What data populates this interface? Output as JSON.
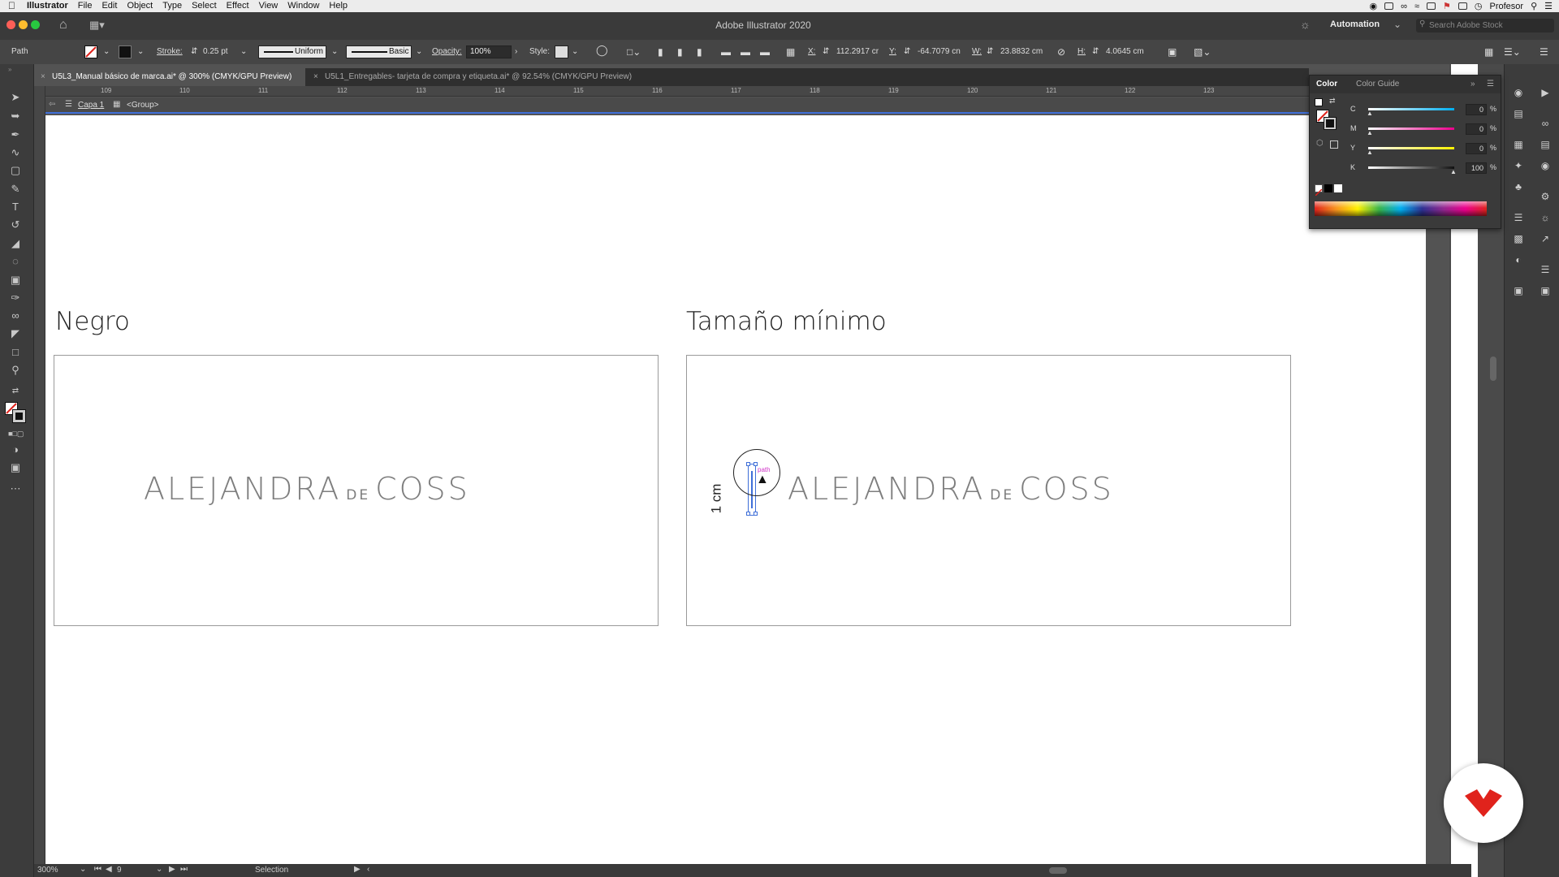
{
  "menubar": {
    "apple": "",
    "app_name": "Illustrator",
    "items": [
      "File",
      "Edit",
      "Object",
      "Type",
      "Select",
      "Effect",
      "View",
      "Window",
      "Help"
    ],
    "user": "Profesor"
  },
  "window": {
    "title": "Adobe Illustrator 2020",
    "workspace": "Automation",
    "search_placeholder": "Search Adobe Stock"
  },
  "control": {
    "selection_type": "Path",
    "stroke_label": "Stroke:",
    "stroke_value": "0.25 pt",
    "profile": "Uniform",
    "brush": "Basic",
    "opacity_label": "Opacity:",
    "opacity_value": "100%",
    "style_label": "Style:",
    "x_label": "X:",
    "x_value": "112.2917 cr",
    "y_label": "Y:",
    "y_value": "-64.7079 cn",
    "w_label": "W:",
    "w_value": "23.8832 cm",
    "h_label": "H:",
    "h_value": "4.0645 cm"
  },
  "tabs": [
    {
      "label": "U5L3_Manual básico de marca.ai* @ 300% (CMYK/GPU Preview)",
      "active": true
    },
    {
      "label": "U5L1_Entregables- tarjeta de compra y etiqueta.ai* @ 92.54% (CMYK/GPU Preview)",
      "active": false
    }
  ],
  "ruler": {
    "ticks": [
      "109",
      "110",
      "111",
      "112",
      "113",
      "114",
      "115",
      "116",
      "117",
      "118",
      "119",
      "120",
      "121",
      "122",
      "123"
    ]
  },
  "breadcrumb": {
    "layer": "Capa 1",
    "group": "<Group>"
  },
  "artboard": {
    "heading_left": "Negro",
    "heading_right": "Tamaño mínimo",
    "logo_first": "ALEJANDRA",
    "logo_middle": "DE",
    "logo_last": "COSS",
    "dimension_label": "1 cm",
    "smart_guide": "path"
  },
  "color_panel": {
    "tab_color": "Color",
    "tab_guide": "Color Guide",
    "channels": [
      {
        "label": "C",
        "value": "0",
        "unit": "%"
      },
      {
        "label": "M",
        "value": "0",
        "unit": "%"
      },
      {
        "label": "Y",
        "value": "0",
        "unit": "%"
      },
      {
        "label": "K",
        "value": "100",
        "unit": "%"
      }
    ]
  },
  "status": {
    "zoom": "300%",
    "artboard_num": "9",
    "tool": "Selection"
  },
  "colors": {
    "accent_blue": "#3f6fd8",
    "badge_red": "#e0231c",
    "cursor_circle": "#222222"
  }
}
